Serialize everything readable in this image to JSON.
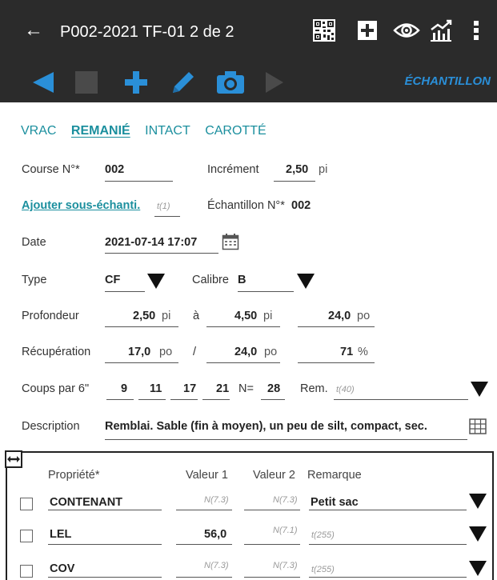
{
  "header": {
    "back_glyph": "←",
    "title": "P002-2021 TF-01 2 de 2",
    "icons": [
      "qr-code-icon",
      "add-box-icon",
      "eye-icon",
      "chart-icon",
      "more-vert-icon"
    ]
  },
  "toolbar": {
    "icons": [
      "previous-icon",
      "stop-icon",
      "add-icon",
      "edit-icon",
      "camera-icon",
      "next-icon"
    ],
    "section_label": "ÉCHANTILLON",
    "accent_color": "#2a8fd8"
  },
  "tabs": [
    {
      "label": "VRAC",
      "active": false
    },
    {
      "label": "REMANIÉ",
      "active": true
    },
    {
      "label": "INTACT",
      "active": false
    },
    {
      "label": "CAROTTÉ",
      "active": false
    }
  ],
  "form": {
    "course_label": "Course N°*",
    "course_value": "002",
    "increment_label": "Incrément",
    "increment_value": "2,50",
    "increment_unit": "pi",
    "add_sub_sample": "Ajouter sous-échanti.",
    "add_sub_placeholder": "t(1)",
    "sample_label": "Échantillon N°*",
    "sample_value": "002",
    "date_label": "Date",
    "date_value": "2021-07-14 17:07",
    "type_label": "Type",
    "type_value": "CF",
    "calibre_label": "Calibre",
    "calibre_value": "B",
    "depth_label": "Profondeur",
    "depth_from": "2,50",
    "depth_from_unit": "pi",
    "depth_to_sep": "à",
    "depth_to": "4,50",
    "depth_to_unit": "pi",
    "depth_len": "24,0",
    "depth_len_unit": "po",
    "recovery_label": "Récupération",
    "recovery_value": "17,0",
    "recovery_unit": "po",
    "recovery_sep": "/",
    "recovery_total": "24,0",
    "recovery_total_unit": "po",
    "recovery_pct": "71",
    "recovery_pct_unit": "%",
    "blows_label": "Coups par 6\"",
    "blows": [
      "9",
      "11",
      "17",
      "21"
    ],
    "n_label": "N=",
    "n_value": "28",
    "rem_label": "Rem.",
    "rem_placeholder": "t(40)",
    "description_label": "Description",
    "description_value": "Remblai. Sable (fin à moyen), un peu de silt, compact, sec."
  },
  "properties": {
    "headers": {
      "property": "Propriété*",
      "value1": "Valeur 1",
      "value2": "Valeur 2",
      "remark": "Remarque"
    },
    "rows": [
      {
        "name": "CONTENANT",
        "value1": "N(7.3)",
        "value1_filled": false,
        "value2": "N(7.3)",
        "remark": "Petit sac",
        "remark_filled": true
      },
      {
        "name": "LEL",
        "value1": "56,0",
        "value1_filled": true,
        "value2": "N(7.1)",
        "remark": "t(255)",
        "remark_filled": false
      },
      {
        "name": "COV",
        "value1": "N(7.3)",
        "value1_filled": false,
        "value2": "N(7.3)",
        "remark": "t(255)",
        "remark_filled": false
      }
    ]
  }
}
